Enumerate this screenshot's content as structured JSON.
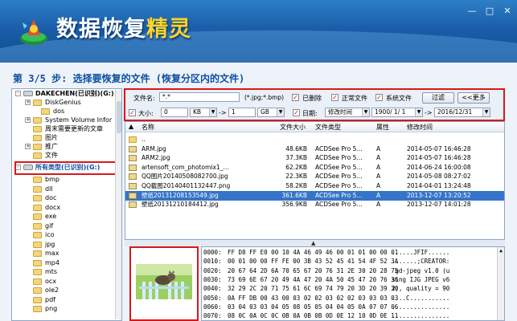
{
  "app": {
    "title_part1": "数据恢复",
    "title_part2": "精灵"
  },
  "window": {
    "minimize": "—",
    "maximize": "□",
    "close": "✕"
  },
  "step_text": "第 3/5 步: 选择要恢复的文件 (恢复分区内的文件)",
  "tree": {
    "items": [
      {
        "label": "DAKECHEN(已识别)(G:)",
        "bold": true
      },
      {
        "label": "DiskGenius"
      },
      {
        "label": "dos"
      },
      {
        "label": "System Volume Infor"
      },
      {
        "label": "周末需要更新的文章"
      },
      {
        "label": "图片"
      },
      {
        "label": "推广"
      },
      {
        "label": "文件"
      },
      {
        "label": "所有类型(已识别)(G:)",
        "bold": true,
        "blue": true
      },
      {
        "label": "bmp"
      },
      {
        "label": "dll"
      },
      {
        "label": "doc"
      },
      {
        "label": "docx"
      },
      {
        "label": "exe"
      },
      {
        "label": "gif"
      },
      {
        "label": "ico"
      },
      {
        "label": "jpg"
      },
      {
        "label": "max"
      },
      {
        "label": "mp4"
      },
      {
        "label": "mts"
      },
      {
        "label": "ocx"
      },
      {
        "label": "ole2"
      },
      {
        "label": "pdf"
      },
      {
        "label": "png"
      }
    ]
  },
  "filter": {
    "filename_label": "文件名:",
    "filename_value": "*.*",
    "filename_hint": "(*.jpg;*.bmp)",
    "deleted_label": "已删除",
    "normal_label": "正常文件",
    "system_label": "系统文件",
    "filter_button": "过滤",
    "more_button": "<<更多",
    "size_label": "大小:",
    "size_from": "0",
    "size_from_unit": "KB",
    "arrow1": "->",
    "size_to": "1",
    "size_to_unit": "GB",
    "date_label": "日期:",
    "date_type": "修改时间",
    "date_from": "1900/ 1/ 1",
    "arrow2": "->",
    "date_to": "2016/12/31"
  },
  "columns": {
    "name": "名称",
    "size": "文件大小",
    "type": "文件类型",
    "attr": "属性",
    "mtime": "修改时间"
  },
  "files": [
    {
      "name": "..",
      "size": "",
      "type": "",
      "attr": "",
      "mtime": "",
      "folder": true
    },
    {
      "name": "ARM.jpg",
      "size": "48.6KB",
      "type": "ACDSee Pro 5...",
      "attr": "A",
      "mtime": "2014-05-07 16:46:28"
    },
    {
      "name": "ARM2.jpg",
      "size": "37.3KB",
      "type": "ACDSee Pro 5...",
      "attr": "A",
      "mtime": "2014-05-07 16:46:28"
    },
    {
      "name": "artensoft_com_photomix1_...",
      "size": "62.2KB",
      "type": "ACDSee Pro 5...",
      "attr": "A",
      "mtime": "2014-06-24 16:00:08"
    },
    {
      "name": "QQ图片20140508082700.jpg",
      "size": "22.3KB",
      "type": "ACDSee Pro 5...",
      "attr": "A",
      "mtime": "2014-05-08 08:27:02"
    },
    {
      "name": "QQ截图20140401132447.png",
      "size": "58.2KB",
      "type": "ACDSee Pro 5...",
      "attr": "A",
      "mtime": "2014-04-01 13:24:48"
    },
    {
      "name": "壁纸20131208153549.jpg",
      "size": "361.6KB",
      "type": "ACDSee Pro 5...",
      "attr": "A",
      "mtime": "2013-12-07 13:20:52",
      "selected": true
    },
    {
      "name": "壁纸20131210184412.jpg",
      "size": "356.9KB",
      "type": "ACDSee Pro 5...",
      "attr": "A",
      "mtime": "2013-12-07 14:01:28"
    }
  ],
  "hex_rows": [
    {
      "off": "0000:",
      "bytes": "FF D8 FF E0 00 10 4A 46 49 46 00 01 01 00 00 01",
      "ascii": "......JFIF......"
    },
    {
      "off": "0010:",
      "bytes": "00 01 00 00 FF FE 00 3B 43 52 45 41 54 4F 52 3A",
      "ascii": ".......;CREATOR:"
    },
    {
      "off": "0020:",
      "bytes": "20 67 64 2D 6A 70 65 67 20 76 31 2E 30 20 28 75",
      "ascii": " gd-jpeg v1.0 (u"
    },
    {
      "off": "0030:",
      "bytes": "73 69 6E 67 20 49 4A 47 20 4A 50 45 47 20 76 36",
      "ascii": "sing IJG JPEG v6"
    },
    {
      "off": "0040:",
      "bytes": "32 29 2C 20 71 75 61 6C 69 74 79 20 3D 20 39 30",
      "ascii": "2), quality = 90"
    },
    {
      "off": "0050:",
      "bytes": "0A FF DB 00 43 00 03 02 02 03 02 02 03 03 03 03",
      "ascii": "....C..........."
    },
    {
      "off": "0060:",
      "bytes": "03 04 03 03 04 05 08 05 05 04 04 05 0A 07 07 06",
      "ascii": "................"
    },
    {
      "off": "0070:",
      "bytes": "08 0C 0A 0C 0C 0B 0A 0B 0B 0D 0E 12 10 0D 0E 11",
      "ascii": "................"
    }
  ],
  "colors": {
    "accent": "#0c4fa3",
    "highlight": "#d9171a",
    "selection": "#3574c8"
  }
}
